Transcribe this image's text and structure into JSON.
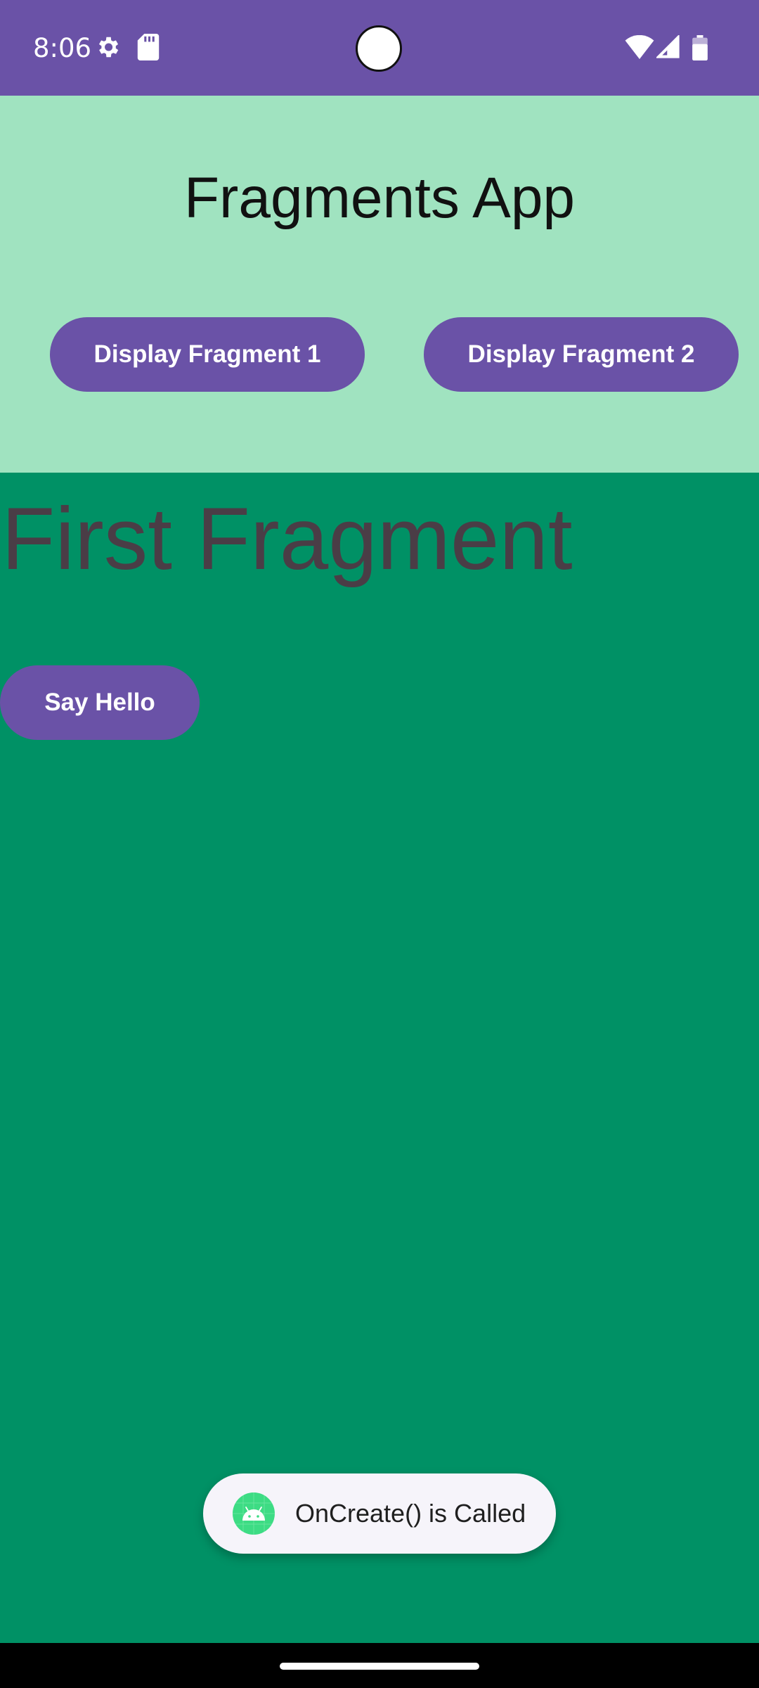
{
  "status_bar": {
    "time": "8:06",
    "icons": [
      "gear-icon",
      "sd-card-icon",
      "wifi-icon",
      "cell-signal-icon",
      "battery-icon"
    ]
  },
  "header": {
    "title": "Fragments App",
    "buttons": [
      {
        "label": "Display Fragment 1"
      },
      {
        "label": "Display Fragment 2"
      }
    ]
  },
  "fragment": {
    "title": "First Fragment",
    "hello_button": "Say Hello"
  },
  "toast": {
    "icon": "android-icon",
    "message": "OnCreate() is Called"
  },
  "colors": {
    "primary": "#6a52a7",
    "header_bg": "#a0e3c0",
    "fragment_bg": "#009165",
    "fragment_title": "#4a3d46",
    "toast_bg": "#f6f4fa"
  }
}
